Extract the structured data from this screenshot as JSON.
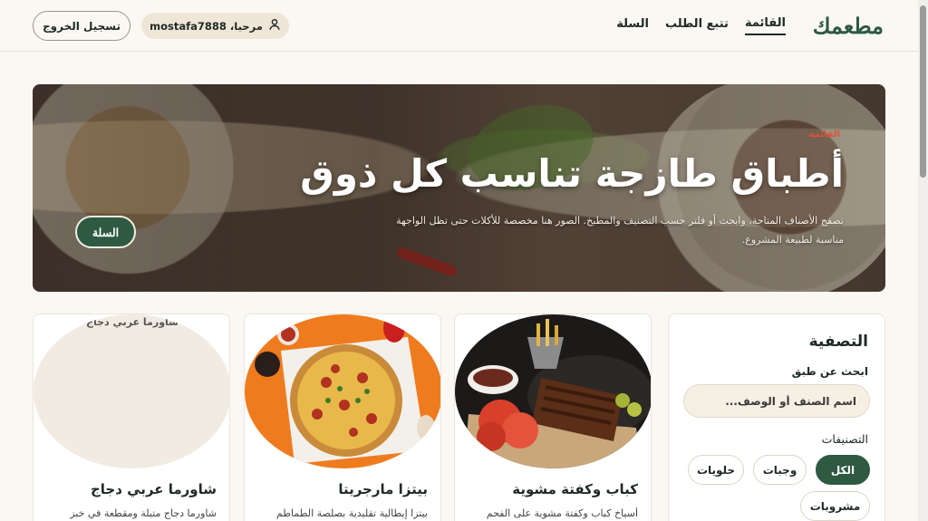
{
  "header": {
    "brand": "مطعمك",
    "nav": [
      {
        "label": "القائمة",
        "active": true
      },
      {
        "label": "تتبع الطلب",
        "active": false
      },
      {
        "label": "السلة",
        "active": false
      }
    ],
    "greeting": "مرحبا، mostafa7888",
    "logout_label": "تسجيل الخروج"
  },
  "hero": {
    "badge": "القائمة",
    "title": "أطباق طازجة تناسب كل ذوق",
    "description": "تصفح الأصناف المتاحة، وابحث أو فلتر حسب التصنيف والمطبخ. الصور هنا مخصصة للأكلات حتى تظل الواجهة مناسبة لطبيعة المشروع.",
    "cart_button": "السلة"
  },
  "filter": {
    "title": "التصفية",
    "search_label": "ابحث عن طبق",
    "search_placeholder": "اسم الصنف أو الوصف...",
    "search_value": "",
    "categories_label": "التصنيفات",
    "categories": [
      {
        "label": "الكل",
        "active": true
      },
      {
        "label": "وجبات",
        "active": false
      },
      {
        "label": "حلويات",
        "active": false
      },
      {
        "label": "مشروبات",
        "active": false
      }
    ]
  },
  "cards": [
    {
      "name": "كباب وكفتة مشوية",
      "description": "أسياخ كباب وكفتة مشوية على الفحم",
      "image": "grilled-ribs-image"
    },
    {
      "name": "بيتزا مارجريتا",
      "description": "بيتزا إيطالية تقليدية بصلصة الطماطم",
      "image": "pizza-image"
    },
    {
      "name": "شاورما عربي دجاج",
      "description": "شاورما دجاج متبلة ومقطعة في خبز",
      "image_alt": "شاورما عربي دجاج"
    }
  ],
  "colors": {
    "brand": "#2e5a42",
    "background": "#fbf8f3",
    "pill": "#efe6d8"
  }
}
